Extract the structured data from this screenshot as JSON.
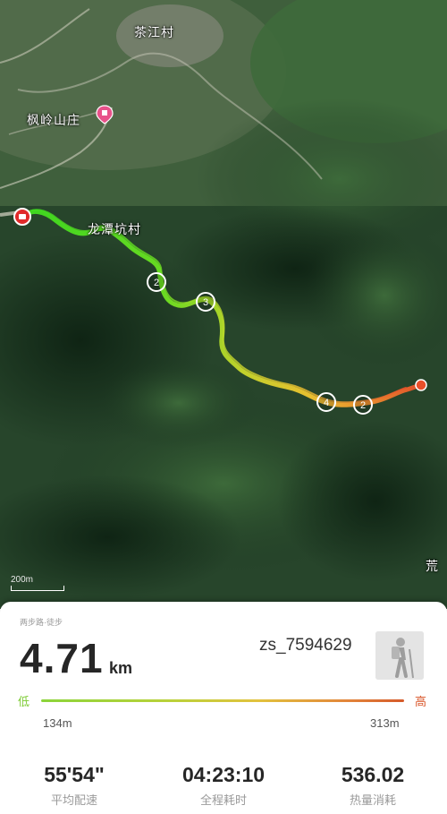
{
  "map": {
    "places": {
      "village_top": "茶江村",
      "resort": "枫岭山庄",
      "village_mid": "龙潭坑村",
      "edge_label": "荒"
    },
    "scale_label": "200m",
    "track_colors": [
      "#3ddc1f",
      "#6be221",
      "#c9d82c",
      "#f2c530",
      "#f08a2e",
      "#ea4f2a"
    ],
    "start_marker_color": "#e02a2a",
    "km_markers": [
      "2",
      "3",
      "4",
      "2"
    ]
  },
  "summary": {
    "activity_type": "两步路·徒步",
    "distance_value": "4.71",
    "distance_unit": "km",
    "username": "zs_7594629",
    "avatar_icon": "hiker-icon"
  },
  "elevation": {
    "low_label": "低",
    "high_label": "高",
    "min": "134m",
    "max": "313m",
    "low_color": "#7ccb33",
    "high_color": "#d9562a"
  },
  "stats": [
    {
      "value": "55'54\"",
      "label": "平均配速"
    },
    {
      "value": "04:23:10",
      "label": "全程耗时"
    },
    {
      "value": "536.02",
      "label": "热量消耗"
    }
  ]
}
